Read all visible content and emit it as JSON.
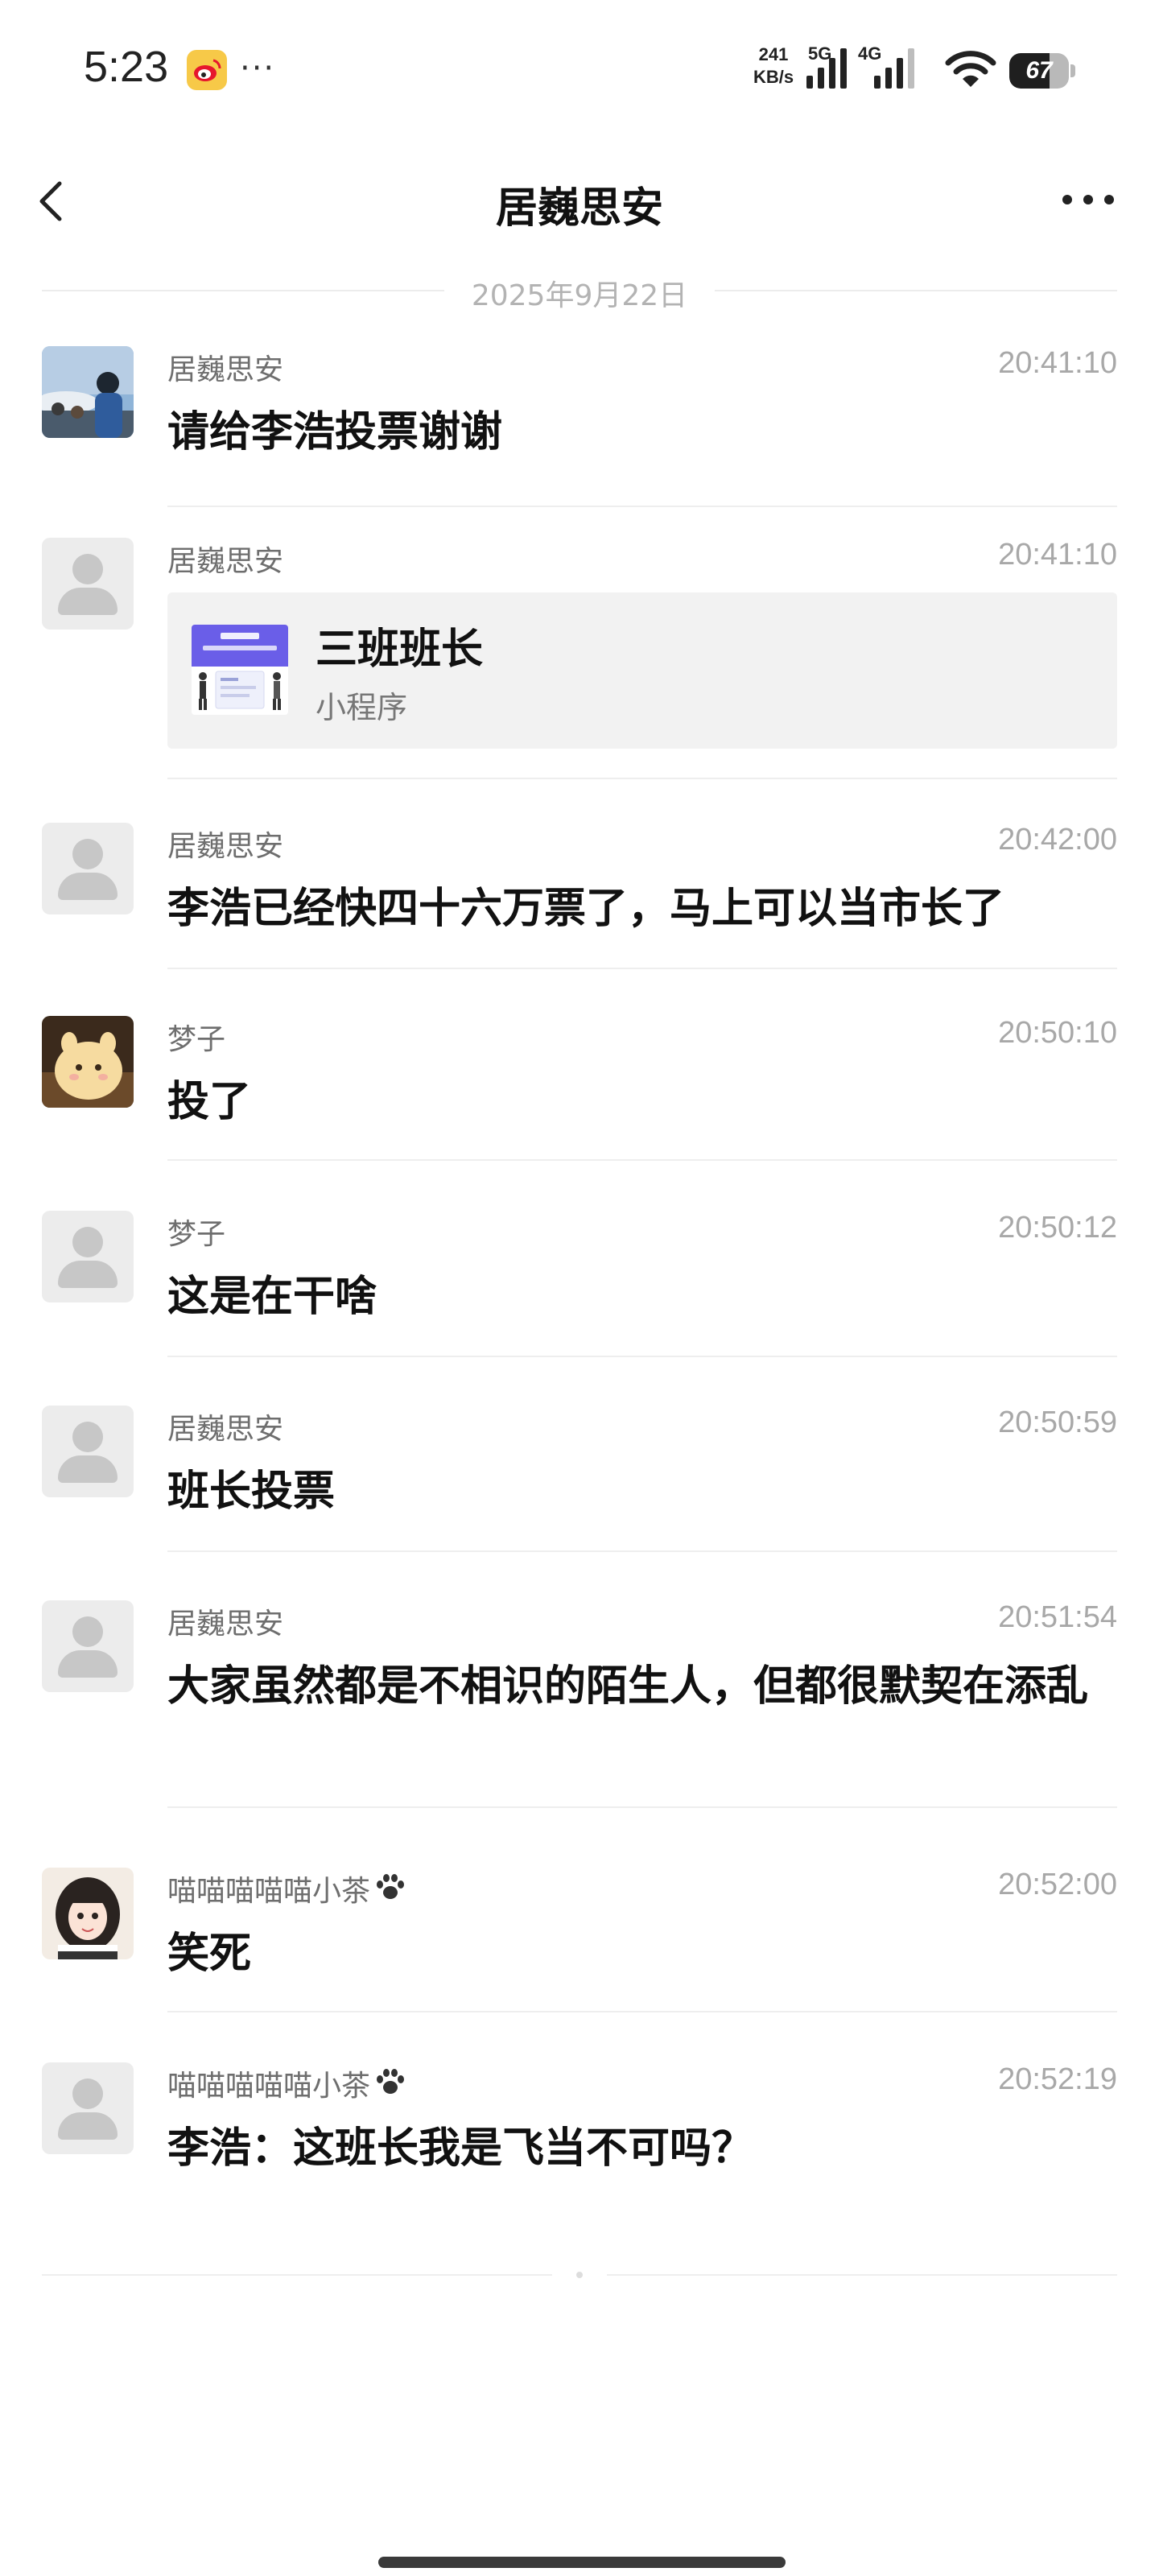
{
  "status_bar": {
    "time": "5:23",
    "more": "···",
    "speed_value": "241",
    "speed_unit": "KB/s",
    "net1": "5G",
    "net2": "4G",
    "battery": "67",
    "battery_level": 0.67,
    "app_icon": "weibo-icon"
  },
  "header": {
    "title": "居巍思安",
    "back_icon": "back-chevron-icon",
    "more_icon": "more-icon"
  },
  "date_divider": "2025年9月22日",
  "messages": [
    {
      "sender": "居巍思安",
      "time": "20:41:10",
      "text": "请给李浩投票谢谢",
      "avatar": "photo"
    },
    {
      "sender": "居巍思安",
      "time": "20:41:10",
      "type": "mini_program",
      "card_title": "三班班长",
      "card_sub": "小程序",
      "avatar": "default"
    },
    {
      "sender": "居巍思安",
      "time": "20:42:00",
      "text": "李浩已经快四十六万票了，马上可以当市长了",
      "avatar": "default"
    },
    {
      "sender": "梦子",
      "time": "20:50:10",
      "text": "投了",
      "avatar": "photo"
    },
    {
      "sender": "梦子",
      "time": "20:50:12",
      "text": "这是在干啥",
      "avatar": "default"
    },
    {
      "sender": "居巍思安",
      "time": "20:50:59",
      "text": "班长投票",
      "avatar": "default"
    },
    {
      "sender": "居巍思安",
      "time": "20:51:54",
      "text": "大家虽然都是不相识的陌生人，但都很默契在添乱",
      "avatar": "default"
    },
    {
      "sender": "喵喵喵喵喵小茶",
      "time": "20:52:00",
      "text": "笑死",
      "avatar": "photo"
    },
    {
      "sender": "喵喵喵喵喵小茶",
      "time": "20:52:19",
      "text": "李浩：这班长我是飞当不可吗？",
      "avatar": "default"
    }
  ],
  "colors": {
    "sender": "#6e6e6e",
    "time": "#a8a8a8",
    "card_bg": "#f2f2f2",
    "mp_banner": "#6a5ee8",
    "weibo": "#f7c948"
  }
}
